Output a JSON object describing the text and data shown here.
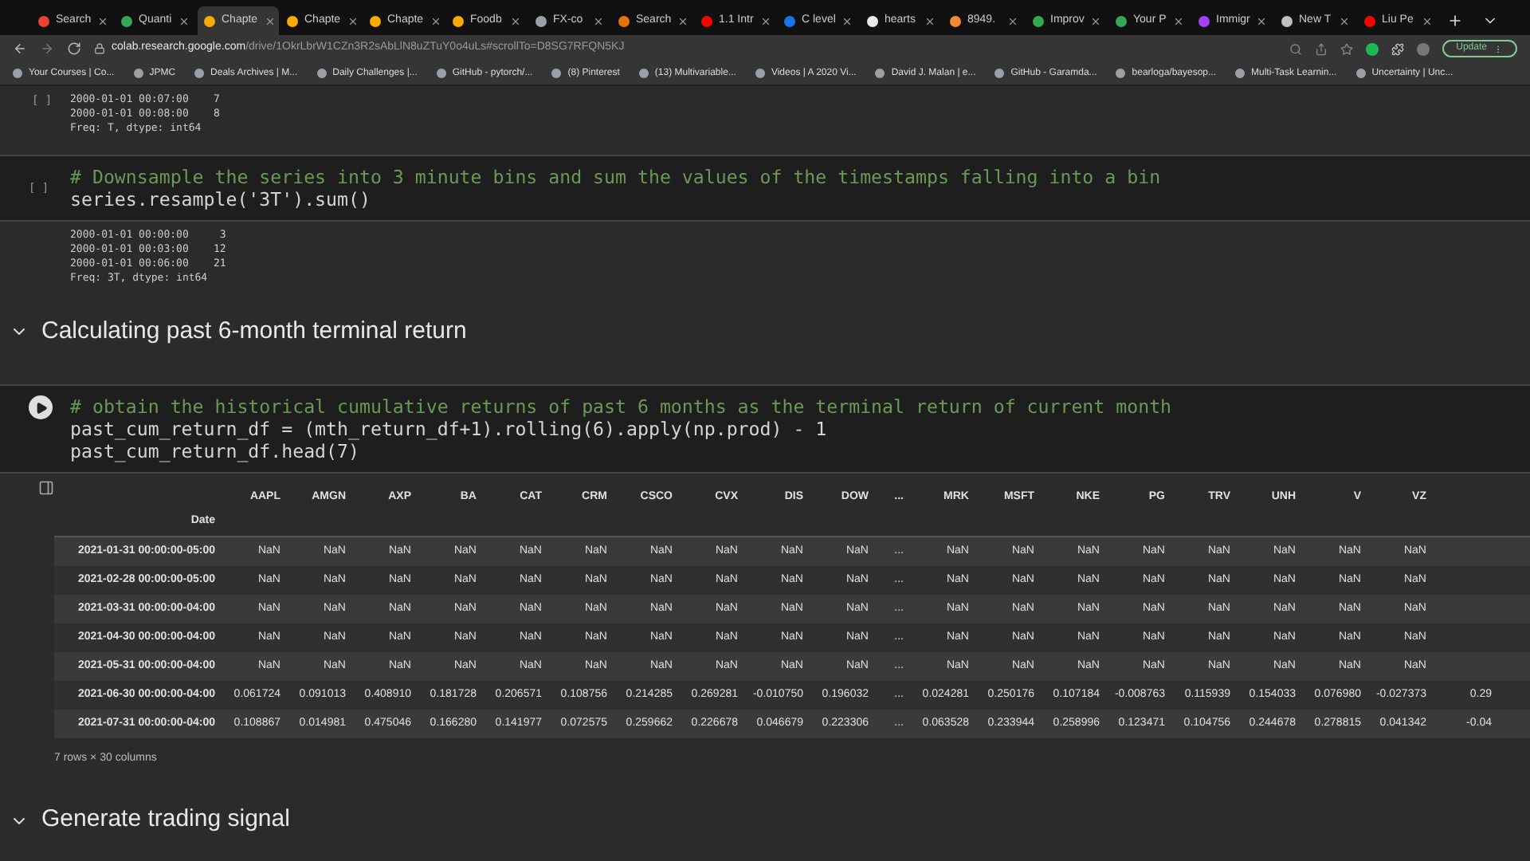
{
  "browser": {
    "tabs": [
      {
        "title": "Search",
        "color": "#ea4335",
        "selected": false
      },
      {
        "title": "Quanti",
        "color": "#34a853",
        "selected": false
      },
      {
        "title": "Chapte",
        "color": "#f9ab00",
        "selected": true
      },
      {
        "title": "Chapte",
        "color": "#f9ab00",
        "selected": false
      },
      {
        "title": "Chapte",
        "color": "#f9ab00",
        "selected": false
      },
      {
        "title": "Foodb",
        "color": "#f9ab00",
        "selected": false
      },
      {
        "title": "FX-co",
        "color": "#9aa0a6",
        "selected": false
      },
      {
        "title": "Search",
        "color": "#e8710a",
        "selected": false
      },
      {
        "title": "1.1 Intr",
        "color": "#ff0000",
        "selected": false
      },
      {
        "title": "C level",
        "color": "#1a73e8",
        "selected": false
      },
      {
        "title": "hearts",
        "color": "#e8eaed",
        "selected": false
      },
      {
        "title": "8949.",
        "color": "#f28b30",
        "selected": false
      },
      {
        "title": "Improv",
        "color": "#34a853",
        "selected": false
      },
      {
        "title": "Your P",
        "color": "#34a853",
        "selected": false
      },
      {
        "title": "Immigr",
        "color": "#a142f4",
        "selected": false
      },
      {
        "title": "New T",
        "color": "#bdc1c6",
        "selected": false
      },
      {
        "title": "Liu Pe",
        "color": "#ff0000",
        "selected": false
      }
    ],
    "url": {
      "host": "colab.research.google.com",
      "path": "/drive/1OkrLbrW1CZn3R2sAbLlN8uZTuY0o4uLs#scrollTo=D8SG7RFQN5KJ"
    },
    "update_button": "Update",
    "bookmarks": [
      "Your Courses | Co...",
      "JPMC",
      "Deals Archives | M...",
      "Daily Challenges |...",
      "GitHub - pytorch/...",
      "(8) Pinterest",
      "(13) Multivariable...",
      "Videos | A 2020 Vi...",
      "David J. Malan | e...",
      "GitHub - Garamda...",
      "bearloga/bayesop...",
      "Multi-Task Learnin...",
      "Uncertainty | Unc..."
    ]
  },
  "notebook": {
    "cells": [
      {
        "kind": "output",
        "prompt": "[ ]",
        "output": [
          "2000-01-01 00:07:00    7",
          "2000-01-01 00:08:00    8",
          "Freq: T, dtype: int64"
        ]
      },
      {
        "kind": "code",
        "prompt": "[ ]",
        "lines": [
          {
            "kind": "comment",
            "text": "# Downsample the series into 3 minute bins and sum the values of the timestamps falling into a bin"
          },
          {
            "kind": "code",
            "text": "series.resample('3T').sum()"
          }
        ],
        "output": [
          "2000-01-01 00:00:00     3",
          "2000-01-01 00:03:00    12",
          "2000-01-01 00:06:00    21",
          "Freq: 3T, dtype: int64"
        ]
      },
      {
        "kind": "heading",
        "text": "Calculating past 6-month terminal return",
        "expanded": true
      },
      {
        "kind": "table",
        "lines": [
          {
            "kind": "comment",
            "text": "# obtain the historical cumulative returns of past 6 months as the terminal return of current month"
          },
          {
            "kind": "code",
            "text": "past_cum_return_df = (mth_return_df+1).rolling(6).apply(np.prod) - 1"
          },
          {
            "kind": "code",
            "text": "past_cum_return_df.head(7)"
          }
        ],
        "table": {
          "columns": [
            "AAPL",
            "AMGN",
            "AXP",
            "BA",
            "CAT",
            "CRM",
            "CSCO",
            "CVX",
            "DIS",
            "DOW",
            "...",
            "MRK",
            "MSFT",
            "NKE",
            "PG",
            "TRV",
            "UNH",
            "V",
            "VZ"
          ],
          "index_name": "Date",
          "rows": [
            {
              "index": "2021-01-31 00:00:00-05:00",
              "cells": [
                "NaN",
                "NaN",
                "NaN",
                "NaN",
                "NaN",
                "NaN",
                "NaN",
                "NaN",
                "NaN",
                "NaN",
                "...",
                "NaN",
                "NaN",
                "NaN",
                "NaN",
                "NaN",
                "NaN",
                "NaN",
                "NaN"
              ]
            },
            {
              "index": "2021-02-28 00:00:00-05:00",
              "cells": [
                "NaN",
                "NaN",
                "NaN",
                "NaN",
                "NaN",
                "NaN",
                "NaN",
                "NaN",
                "NaN",
                "NaN",
                "...",
                "NaN",
                "NaN",
                "NaN",
                "NaN",
                "NaN",
                "NaN",
                "NaN",
                "NaN"
              ]
            },
            {
              "index": "2021-03-31 00:00:00-04:00",
              "cells": [
                "NaN",
                "NaN",
                "NaN",
                "NaN",
                "NaN",
                "NaN",
                "NaN",
                "NaN",
                "NaN",
                "NaN",
                "...",
                "NaN",
                "NaN",
                "NaN",
                "NaN",
                "NaN",
                "NaN",
                "NaN",
                "NaN"
              ]
            },
            {
              "index": "2021-04-30 00:00:00-04:00",
              "cells": [
                "NaN",
                "NaN",
                "NaN",
                "NaN",
                "NaN",
                "NaN",
                "NaN",
                "NaN",
                "NaN",
                "NaN",
                "...",
                "NaN",
                "NaN",
                "NaN",
                "NaN",
                "NaN",
                "NaN",
                "NaN",
                "NaN"
              ]
            },
            {
              "index": "2021-05-31 00:00:00-04:00",
              "cells": [
                "NaN",
                "NaN",
                "NaN",
                "NaN",
                "NaN",
                "NaN",
                "NaN",
                "NaN",
                "NaN",
                "NaN",
                "...",
                "NaN",
                "NaN",
                "NaN",
                "NaN",
                "NaN",
                "NaN",
                "NaN",
                "NaN"
              ]
            },
            {
              "index": "2021-06-30 00:00:00-04:00",
              "cells": [
                "0.061724",
                "0.091013",
                "0.408910",
                "0.181728",
                "0.206571",
                "0.108756",
                "0.214285",
                "0.269281",
                "-0.010750",
                "0.196032",
                "...",
                "0.024281",
                "0.250176",
                "0.107184",
                "-0.008763",
                "0.115939",
                "0.154033",
                "0.076980",
                "-0.027373",
                "0.29"
              ]
            },
            {
              "index": "2021-07-31 00:00:00-04:00",
              "cells": [
                "0.108867",
                "0.014981",
                "0.475046",
                "0.166280",
                "0.141977",
                "0.072575",
                "0.259662",
                "0.226678",
                "0.046679",
                "0.223306",
                "...",
                "0.063528",
                "0.233944",
                "0.258996",
                "0.123471",
                "0.104756",
                "0.244678",
                "0.278815",
                "0.041342",
                "-0.04"
              ]
            }
          ],
          "footer": "7 rows × 30 columns"
        }
      },
      {
        "kind": "heading",
        "text": "Generate trading signal",
        "expanded": true
      }
    ]
  }
}
